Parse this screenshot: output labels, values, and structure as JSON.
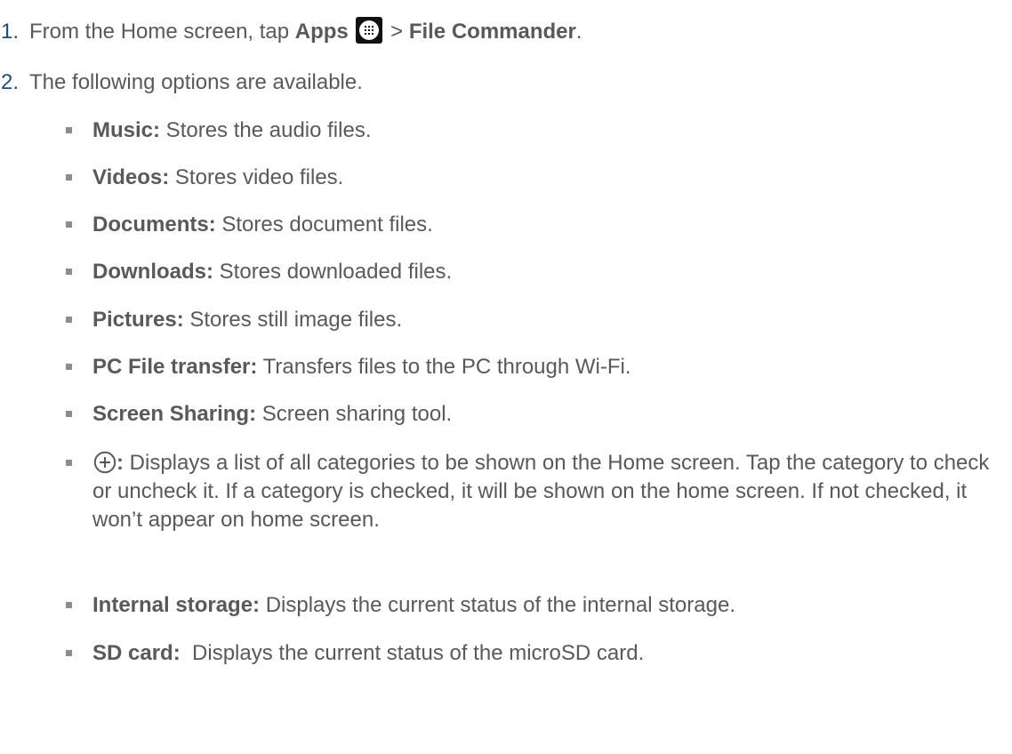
{
  "steps": [
    {
      "number": "1.",
      "pre": "From the Home screen, tap ",
      "apps_label": "Apps",
      "separator": " > ",
      "target_label": "File Commander",
      "end": "."
    },
    {
      "number": "2.",
      "text": "The following options are available."
    }
  ],
  "options": [
    {
      "label": "Music:",
      "desc": " Stores the audio files."
    },
    {
      "label": "Videos:",
      "desc": " Stores video files."
    },
    {
      "label": "Documents:",
      "desc": " Stores document files."
    },
    {
      "label": "Downloads:",
      "desc": " Stores downloaded files."
    },
    {
      "label": "Pictures:",
      "desc": " Stores still image files."
    },
    {
      "label": "PC File transfer:",
      "desc": " Transfers files to the PC through Wi-Fi."
    },
    {
      "label": "Screen Sharing:",
      "desc": " Screen sharing tool."
    },
    {
      "icon": "plus-circle-icon",
      "label": ":",
      "desc": " Displays a list of all categories to be shown on the Home screen. Tap the category to check or uncheck it. If a category is checked, it will be shown on the home screen. If not checked, it won’t appear on home screen."
    },
    {
      "label": "Internal storage:",
      "desc": " Displays the current status of the internal storage."
    },
    {
      "label": "SD card:",
      "desc": "  Displays the current status of the microSD card."
    }
  ],
  "icons": {
    "apps": "apps-grid-icon",
    "add": "plus-circle-icon"
  },
  "colors": {
    "text": "#595959",
    "step_number": "#1f4e79",
    "bullet": "#8c8c8c"
  }
}
